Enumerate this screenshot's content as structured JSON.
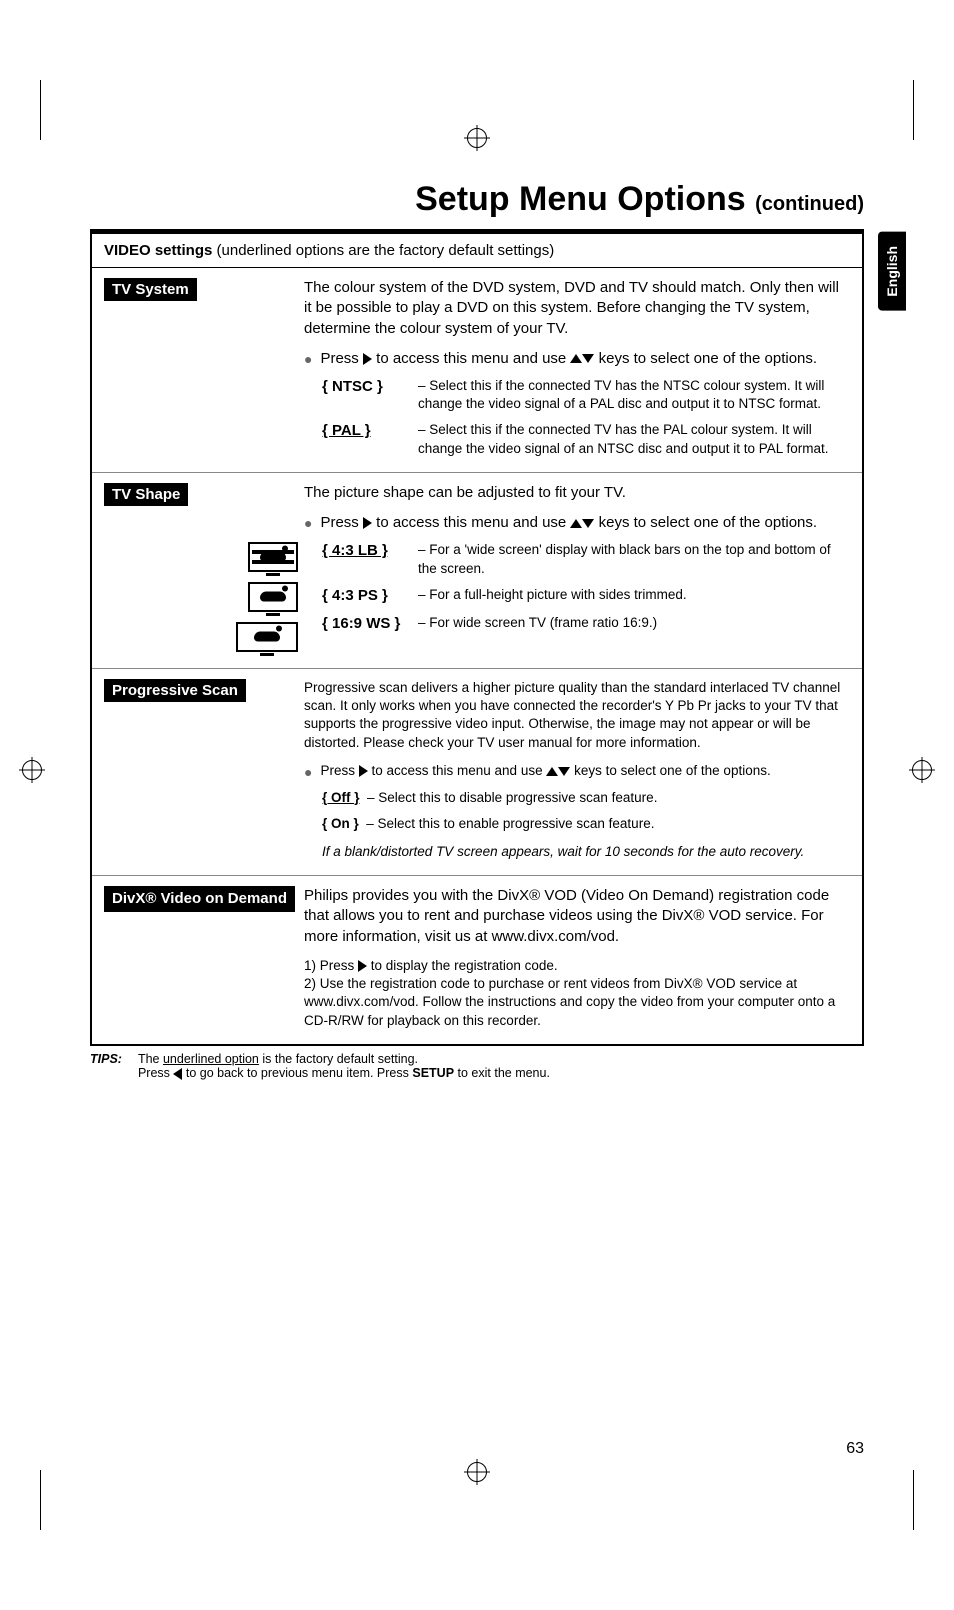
{
  "page": {
    "title": "Setup Menu Options",
    "continued": "(continued)",
    "language_tab": "English",
    "page_number": "63"
  },
  "box_header": {
    "title": "VIDEO settings",
    "note": " (underlined options are the factory default settings)"
  },
  "tv_system": {
    "label": "TV System",
    "intro": "The colour system of the DVD system, DVD and TV should match. Only then will it be possible to play a DVD on this system. Before changing the TV system, determine the colour system of your TV.",
    "press": "Press ",
    "press_after": " to access this menu and use ",
    "press_tail": " keys to select one of the options.",
    "ntsc_label": "{ NTSC }",
    "ntsc_desc": "– Select this if the connected TV has the NTSC colour system. It will change the video signal of a PAL disc and output it to NTSC format.",
    "pal_label": "{ PAL }",
    "pal_desc": "– Select this if the connected TV has the PAL colour system. It will change the video signal of an NTSC disc and output it to PAL format."
  },
  "tv_shape": {
    "label": "TV Shape",
    "intro": "The picture shape can be adjusted to fit your TV.",
    "press": "Press ",
    "press_after": " to access this menu and use ",
    "press_tail": " keys to select one of the options.",
    "lb_label": "{ 4:3 LB }",
    "lb_desc": "– For a 'wide screen' display with black bars on the top and bottom of the screen.",
    "ps_label": "{ 4:3 PS }",
    "ps_desc": "– For a full-height picture with sides trimmed.",
    "ws_label": "{ 16:9 WS }",
    "ws_desc": " – For wide screen TV (frame ratio 16:9.)"
  },
  "progressive": {
    "label": "Progressive Scan",
    "intro": "Progressive scan delivers a higher picture quality than the standard interlaced TV channel scan. It only works when you have connected the recorder's Y Pb Pr jacks to your TV that supports the progressive video input. Otherwise, the image may not appear or will be distorted. Please check your TV user manual for more information.",
    "press": "Press ",
    "press_after": " to access this menu and use ",
    "press_tail": " keys to select one of the options.",
    "off_label": "{ Off }",
    "off_desc": "– Select this to disable progressive scan feature.",
    "on_label": "{ On }",
    "on_desc": "– Select this to enable progressive scan feature.",
    "note": "If a blank/distorted TV screen appears, wait for 10 seconds for the auto recovery."
  },
  "divx": {
    "label": "DivX® Video on Demand",
    "intro": "Philips provides you with the DivX® VOD (Video On Demand) registration code that allows you to rent and purchase videos using the DivX® VOD service. For more information, visit us at www.divx.com/vod.",
    "step1_pre": "1) Press ",
    "step1_post": " to display the registration code.",
    "step2": "2) Use the registration code to purchase or rent videos from DivX® VOD service at www.divx.com/vod. Follow the instructions and copy the video from your computer onto a CD-R/RW for playback on this recorder."
  },
  "tips": {
    "label": "TIPS:",
    "line1_pre": "The ",
    "line1_u": "underlined option",
    "line1_post": " is the factory default setting.",
    "line2_pre": "Press ",
    "line2_mid": " to go back to previous menu item. Press ",
    "line2_b": "SETUP",
    "line2_post": " to exit the menu."
  }
}
